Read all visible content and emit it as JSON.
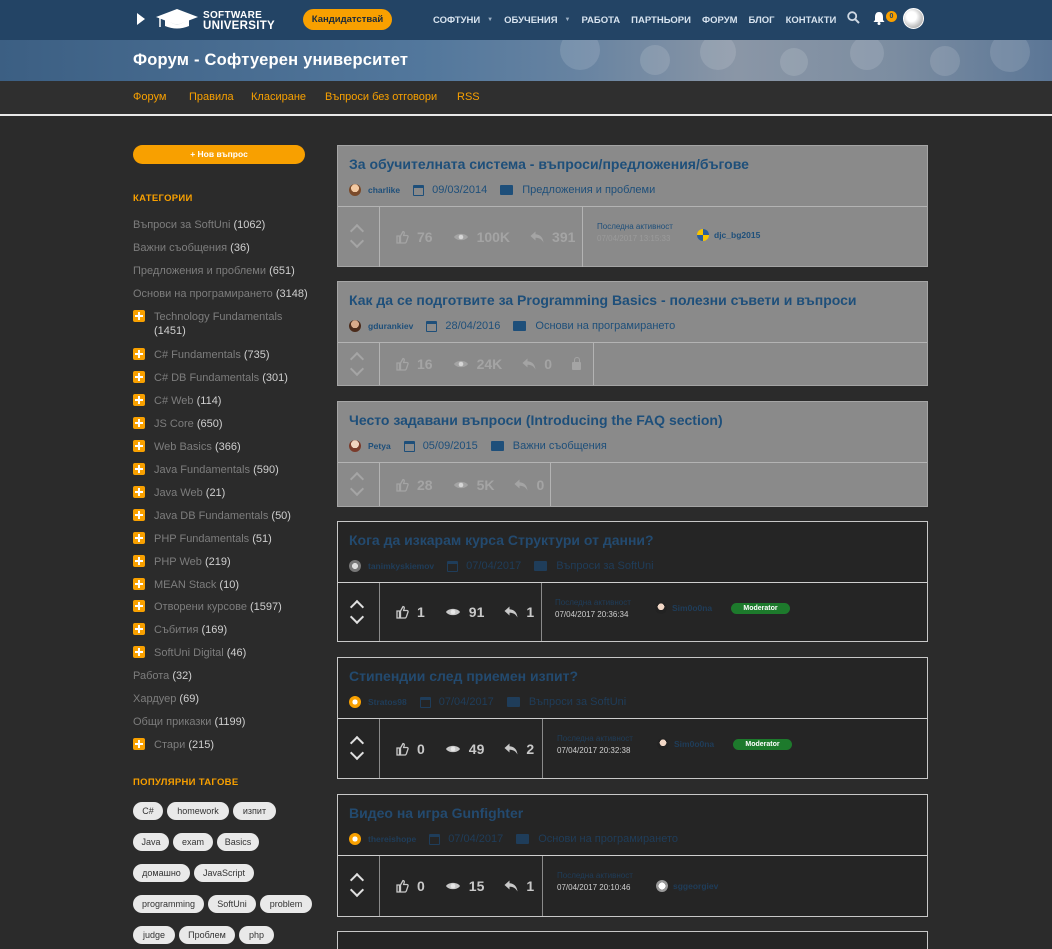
{
  "nav": {
    "logo_line1": "SOFTWARE",
    "logo_line2": "UNIVERSITY",
    "apply_label": "Кандидатствай",
    "menu": [
      "СОФТУНИ",
      "ОБУЧЕНИЯ",
      "РАБОТА",
      "ПАРТНЬОРИ",
      "ФОРУМ",
      "БЛОГ",
      "КОНТАКТИ"
    ],
    "notifications": "0"
  },
  "banner": {
    "title": "Форум - Софтуерен университет"
  },
  "subnav": [
    "Форум",
    "Правила",
    "Класиране",
    "Въпроси без отговори",
    "RSS"
  ],
  "sidebar": {
    "new_question": "+ Нов въпрос",
    "categories_heading": "КАТЕГОРИИ",
    "categories": [
      {
        "name": "Въпроси за SoftUni",
        "count": "(1062)"
      },
      {
        "name": "Важни съобщения",
        "count": "(36)"
      },
      {
        "name": "Предложения и проблеми",
        "count": "(651)"
      },
      {
        "name": "Основи на програмирането",
        "count": "(3148)"
      }
    ],
    "subcategories": [
      {
        "name": "Technology Fundamentals",
        "count": "(1451)"
      },
      {
        "name": "C# Fundamentals",
        "count": "(735)"
      },
      {
        "name": "C# DB Fundamentals",
        "count": "(301)"
      },
      {
        "name": "C# Web",
        "count": "(114)"
      },
      {
        "name": "JS Core",
        "count": "(650)"
      },
      {
        "name": "Web Basics",
        "count": "(366)"
      },
      {
        "name": "Java Fundamentals",
        "count": "(590)"
      },
      {
        "name": "Java Web",
        "count": "(21)"
      },
      {
        "name": "Java DB Fundamentals",
        "count": "(50)"
      },
      {
        "name": "PHP Fundamentals",
        "count": "(51)"
      },
      {
        "name": "PHP Web",
        "count": "(219)"
      },
      {
        "name": "MEAN Stack",
        "count": "(10)"
      },
      {
        "name": "Отворени курсове",
        "count": "(1597)"
      },
      {
        "name": "Събития",
        "count": "(169)"
      },
      {
        "name": "SoftUni Digital",
        "count": "(46)"
      }
    ],
    "categories2": [
      {
        "name": "Работа",
        "count": "(32)"
      },
      {
        "name": "Хардуер",
        "count": "(69)"
      },
      {
        "name": "Общи приказки",
        "count": "(1199)"
      }
    ],
    "old": {
      "name": "Стари",
      "count": "(215)"
    },
    "tags_heading": "ПОПУЛЯРНИ ТАГОВЕ",
    "tags": [
      [
        "C#",
        "homework",
        "изпит"
      ],
      [
        "Java",
        "exam",
        "Basics"
      ],
      [
        "домашно",
        "JavaScript"
      ],
      [
        "programming",
        "SoftUni",
        "problem"
      ],
      [
        "judge",
        "Проблем",
        "php"
      ]
    ]
  },
  "posts": [
    {
      "title": "За обучителната система - въпроси/предложения/бъгове",
      "author": "charlike",
      "date": "09/03/2014",
      "category": "Предложения и проблеми",
      "likes": "76",
      "views": "100K",
      "replies": "391",
      "activity_label": "Последна активност",
      "activity_time": "07/04/2017 13:15:33",
      "last_user": "djc_bg2015"
    },
    {
      "title": "Как да се подготвите за Programming Basics - полезни съвети и въпроси",
      "author": "gdurankiev",
      "date": "28/04/2016",
      "category": "Основи на програмирането",
      "likes": "16",
      "views": "24K",
      "replies": "0"
    },
    {
      "title": "Често задавани въпроси (Introducing the FAQ section)",
      "author": "Petya",
      "date": "05/09/2015",
      "category": "Важни съобщения",
      "likes": "28",
      "views": "5K",
      "replies": "0"
    },
    {
      "title": "Кога да изкарам курса Структури от данни?",
      "author": "tanimkyskiemov",
      "date": "07/04/2017",
      "category": "Въпроси за SoftUni",
      "likes": "1",
      "views": "91",
      "replies": "1",
      "activity_label": "Последна активност",
      "activity_time": "07/04/2017 20:36:34",
      "last_user": "Sim0o0na",
      "badge": "Moderator"
    },
    {
      "title": "Стипендии след приемен изпит?",
      "author": "Stratos98",
      "date": "07/04/2017",
      "category": "Въпроси за SoftUni",
      "likes": "0",
      "views": "49",
      "replies": "2",
      "activity_label": "Последна активност",
      "activity_time": "07/04/2017 20:32:38",
      "last_user": "Sim0o0na",
      "badge": "Moderator"
    },
    {
      "title": "Видео на игра Gunfighter",
      "author": "thereishope",
      "date": "07/04/2017",
      "category": "Основи на програмирането",
      "likes": "0",
      "views": "15",
      "replies": "1",
      "activity_label": "Последна активност",
      "activity_time": "07/04/2017 20:10:46",
      "last_user": "sggeorgiev"
    }
  ],
  "colors": {
    "accent": "#f8a000",
    "nav": "#234465",
    "moderator": "#1d7a2c"
  }
}
